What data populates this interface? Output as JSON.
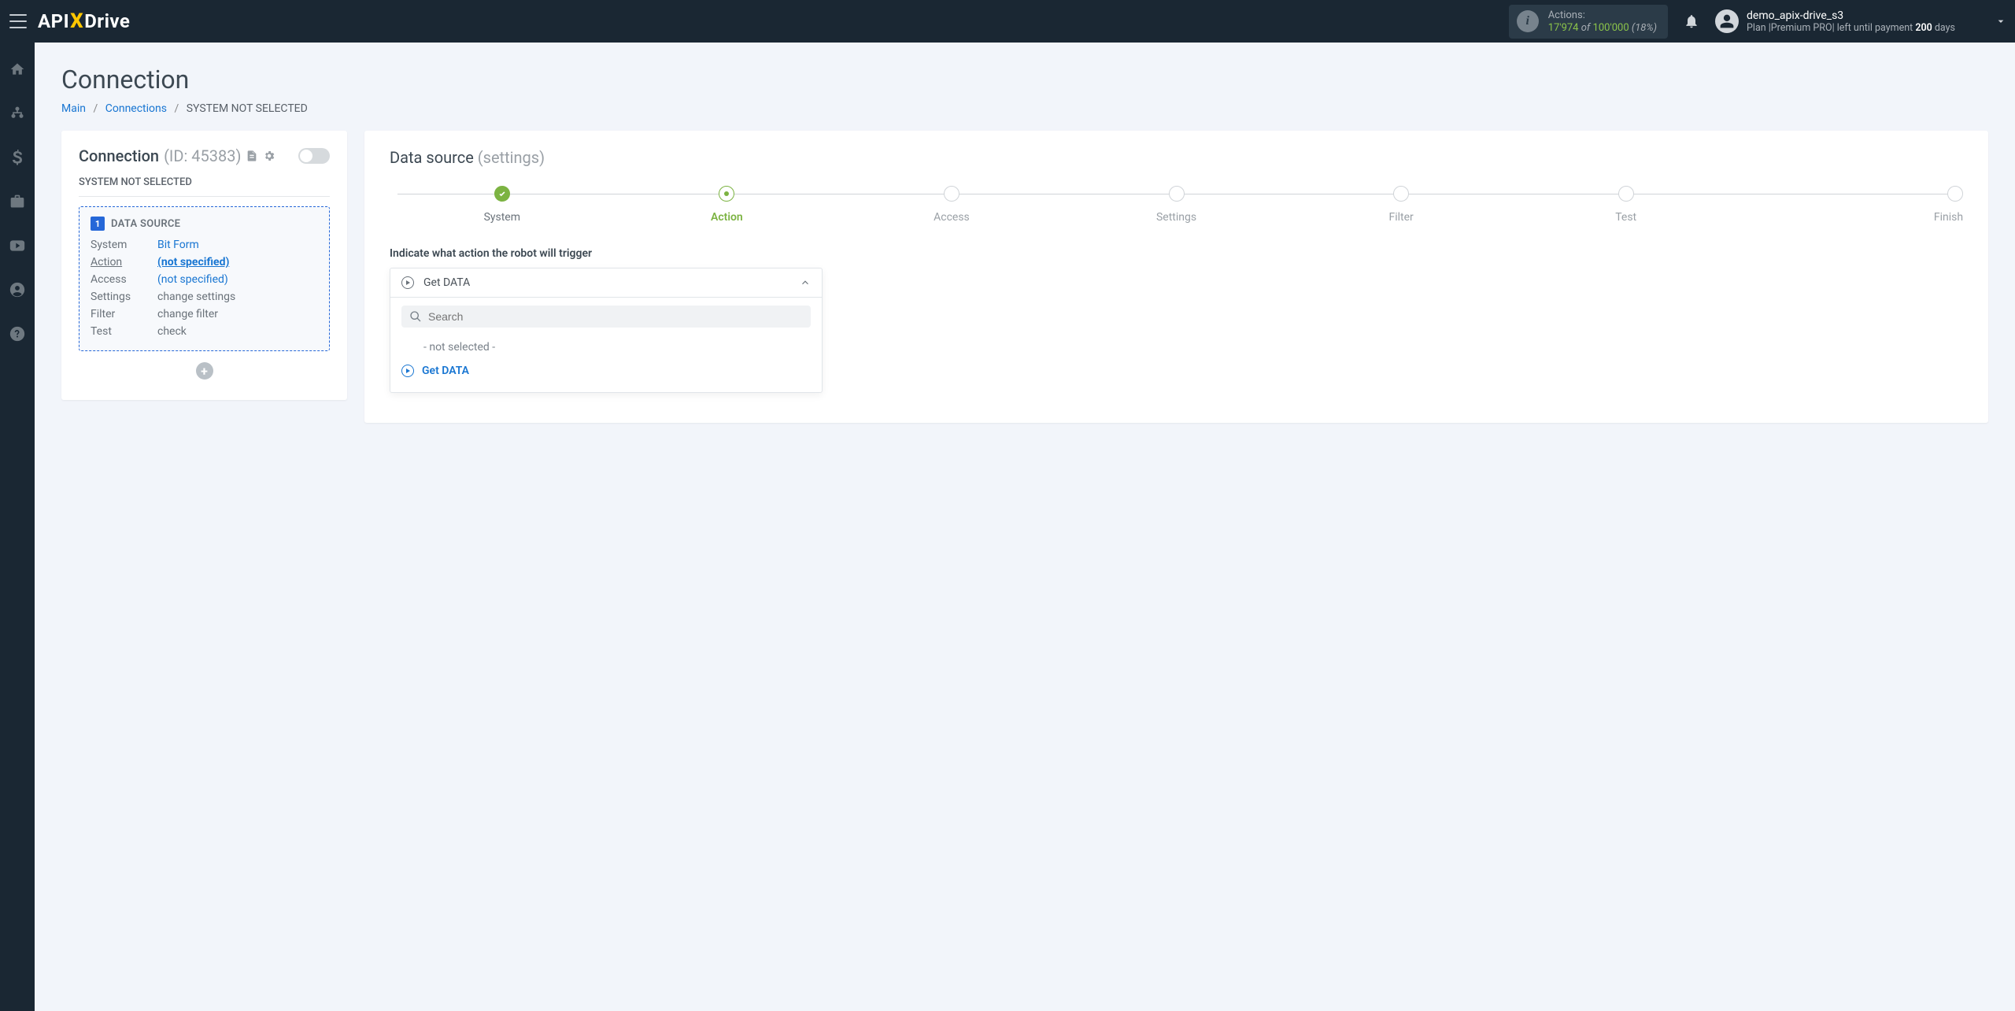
{
  "topbar": {
    "logo": {
      "part1": "API",
      "x": "X",
      "part2": "Drive"
    },
    "actions": {
      "label": "Actions:",
      "current": "17'974",
      "of": "of",
      "total": "100'000",
      "pct": "(18%)"
    },
    "user": {
      "name": "demo_apix-drive_s3",
      "plan_prefix": "Plan |",
      "plan_name": "Premium PRO",
      "plan_mid": "| left until payment ",
      "days_num": "200",
      "days_suffix": " days"
    }
  },
  "page": {
    "title": "Connection"
  },
  "breadcrumb": {
    "main": "Main",
    "connections": "Connections",
    "current": "SYSTEM NOT SELECTED"
  },
  "left": {
    "conn_label": "Connection",
    "conn_id": "(ID: 45383)",
    "not_selected": "SYSTEM NOT SELECTED",
    "ds_num": "1",
    "ds_title": "DATA SOURCE",
    "rows": {
      "system": {
        "k": "System",
        "v": "Bit Form"
      },
      "action": {
        "k": "Action",
        "v": "(not specified)"
      },
      "access": {
        "k": "Access",
        "v": "(not specified)"
      },
      "settings": {
        "k": "Settings",
        "v": "change settings"
      },
      "filter": {
        "k": "Filter",
        "v": "change filter"
      },
      "test": {
        "k": "Test",
        "v": "check"
      }
    }
  },
  "right": {
    "title": "Data source",
    "subtitle": "(settings)",
    "steps": {
      "system": "System",
      "action": "Action",
      "access": "Access",
      "settings": "Settings",
      "filter": "Filter",
      "test": "Test",
      "finish": "Finish"
    },
    "prompt": "Indicate what action the robot will trigger",
    "selected": "Get DATA",
    "search_ph": "Search",
    "opts": {
      "none": "- not selected -",
      "get": "Get DATA"
    }
  }
}
